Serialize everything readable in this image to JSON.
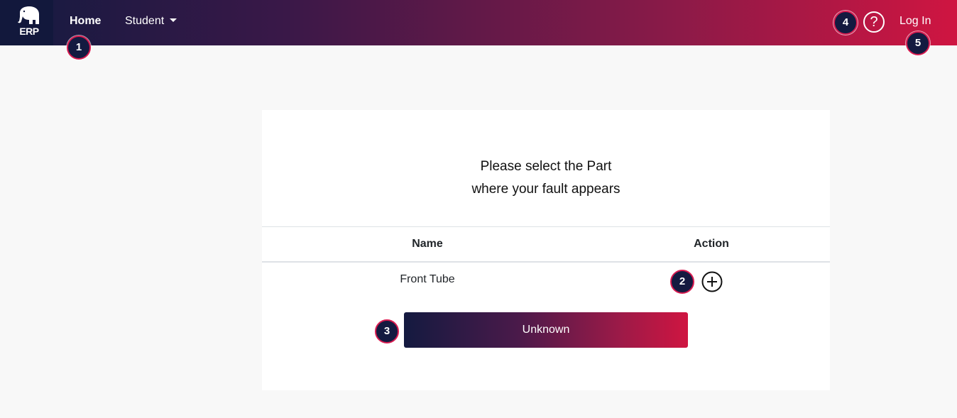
{
  "navbar": {
    "logo_text": "ERP",
    "home_label": "Home",
    "student_label": "Student",
    "help_glyph": "?",
    "login_label": "Log In"
  },
  "badges": {
    "b1": "1",
    "b2": "2",
    "b3": "3",
    "b4": "4",
    "b5": "5"
  },
  "card": {
    "heading_line1": "Please select the Part",
    "heading_line2": "where your fault appears",
    "table": {
      "columns": [
        "Name",
        "Action"
      ],
      "rows": [
        {
          "name": "Front Tube"
        }
      ]
    },
    "unknown_button_label": "Unknown"
  },
  "icons": {
    "logo": "elephant-logo-icon",
    "help": "question-circle-icon",
    "add": "plus-circle-icon",
    "dropdown": "caret-down-icon"
  },
  "colors": {
    "brand_dark": "#141a40",
    "brand_accent": "#cf1541",
    "page_bg": "#f8f8f8"
  }
}
